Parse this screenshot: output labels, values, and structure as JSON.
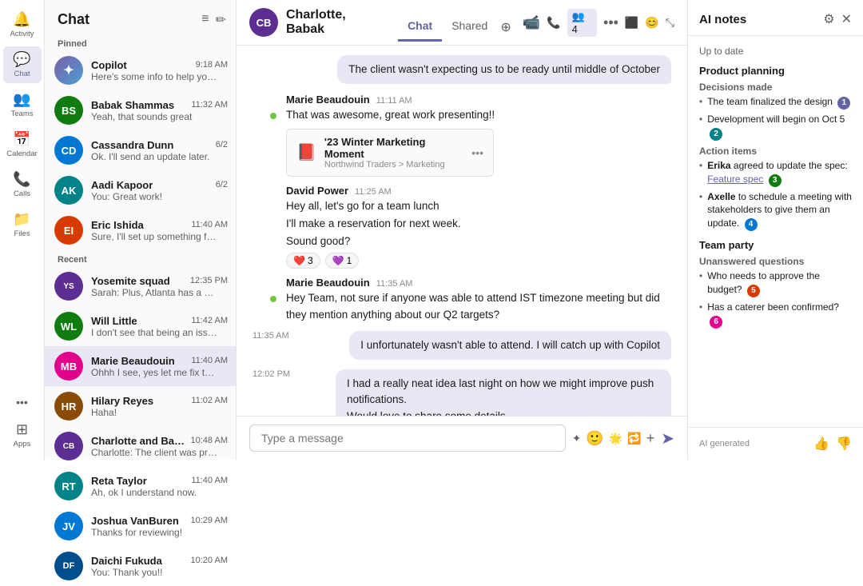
{
  "nav": {
    "items": [
      {
        "id": "activity",
        "label": "Activity",
        "icon": "🔔",
        "active": false
      },
      {
        "id": "chat",
        "label": "Chat",
        "icon": "💬",
        "active": true
      },
      {
        "id": "teams",
        "label": "Teams",
        "icon": "👥",
        "active": false
      },
      {
        "id": "calendar",
        "label": "Calendar",
        "icon": "📅",
        "active": false
      },
      {
        "id": "calls",
        "label": "Calls",
        "icon": "📞",
        "active": false
      },
      {
        "id": "files",
        "label": "Files",
        "icon": "📁",
        "active": false
      },
      {
        "id": "more",
        "label": "···",
        "icon": "···",
        "active": false
      },
      {
        "id": "apps",
        "label": "Apps",
        "icon": "⊞",
        "active": false
      }
    ]
  },
  "chatList": {
    "title": "Chat",
    "pinnedLabel": "Pinned",
    "recentLabel": "Recent",
    "pinned": [
      {
        "id": "copilot",
        "name": "Copilot",
        "preview": "Here's some info to help you prep for your...",
        "time": "9:18 AM",
        "avatarColor": "copilot",
        "initials": "🤖",
        "online": false
      },
      {
        "id": "babak",
        "name": "Babak Shammas",
        "preview": "Yeah, that sounds great",
        "time": "11:32 AM",
        "avatarColor": "green",
        "initials": "BS",
        "online": false
      },
      {
        "id": "cassandra",
        "name": "Cassandra Dunn",
        "preview": "Ok. I'll send an update later.",
        "time": "6/2",
        "avatarColor": "blue",
        "initials": "CD",
        "online": false
      },
      {
        "id": "aadi",
        "name": "Aadi Kapoor",
        "preview": "You: Great work!",
        "time": "6/2",
        "avatarColor": "teal",
        "initials": "AK",
        "online": false
      },
      {
        "id": "eric",
        "name": "Eric Ishida",
        "preview": "Sure, I'll set up something for next week t...",
        "time": "11:40 AM",
        "avatarColor": "orange",
        "initials": "EI",
        "online": false
      }
    ],
    "recent": [
      {
        "id": "yosemite",
        "name": "Yosemite squad",
        "preview": "Sarah: Plus, Atlanta has a growing tech...",
        "time": "12:35 PM",
        "avatarColor": "purple",
        "initials": "YS",
        "online": false
      },
      {
        "id": "will",
        "name": "Will Little",
        "preview": "I don't see that being an issue. Can you ta...",
        "time": "11:42 AM",
        "avatarColor": "green",
        "initials": "WL",
        "online": false
      },
      {
        "id": "marie",
        "name": "Marie Beaudouin",
        "preview": "Ohhh I see, yes let me fix that!",
        "time": "11:40 AM",
        "avatarColor": "pink",
        "initials": "MB",
        "online": false
      },
      {
        "id": "hilary",
        "name": "Hilary Reyes",
        "preview": "Haha!",
        "time": "11:02 AM",
        "avatarColor": "brown",
        "initials": "HR",
        "online": false
      },
      {
        "id": "charlotte",
        "name": "Charlotte and Babak",
        "preview": "Charlotte: The client was pretty happy with...",
        "time": "10:48 AM",
        "avatarColor": "purple",
        "initials": "CB",
        "online": false
      },
      {
        "id": "reta",
        "name": "Reta Taylor",
        "preview": "Ah, ok I understand now.",
        "time": "11:40 AM",
        "avatarColor": "teal",
        "initials": "RT",
        "online": false
      },
      {
        "id": "joshua",
        "name": "Joshua VanBuren",
        "preview": "Thanks for reviewing!",
        "time": "10:29 AM",
        "avatarColor": "blue",
        "initials": "JV",
        "online": false
      },
      {
        "id": "daichi",
        "name": "Daichi Fukuda",
        "preview": "You: Thank you!!",
        "time": "10:20 AM",
        "avatarColor": "darkblue",
        "initials": "DF",
        "online": false
      }
    ]
  },
  "header": {
    "name": "Charlotte, Babak",
    "tab_chat": "Chat",
    "tab_shared": "Shared"
  },
  "messages": [
    {
      "id": "m1",
      "type": "bubble-right",
      "text": "The client wasn't expecting us to be ready until middle of October"
    },
    {
      "id": "m2",
      "type": "left",
      "sender": "Marie Beaudouin",
      "time": "11:11 AM",
      "avatarColor": "pink",
      "initials": "MB",
      "online": true,
      "text": "That was awesome, great work presenting!!",
      "hasFile": true,
      "fileName": "'23 Winter Marketing Moment",
      "filePath": "Northwind Traders > Marketing"
    },
    {
      "id": "m3",
      "type": "left",
      "sender": "David Power",
      "time": "11:25 AM",
      "avatarColor": "blue",
      "initials": "DP",
      "online": false,
      "lines": [
        "Hey all, let's go for a team lunch",
        "I'll make a reservation for next week.",
        "Sound good?"
      ],
      "reactions": [
        {
          "emoji": "❤️",
          "count": "3"
        },
        {
          "emoji": "💜",
          "count": "1"
        }
      ]
    },
    {
      "id": "m4",
      "type": "left",
      "sender": "Marie Beaudouin",
      "time": "11:35 AM",
      "avatarColor": "pink",
      "initials": "MB",
      "online": true,
      "text": "Hey Team, not sure if anyone was able to attend IST timezone meeting but did they mention anything about our Q2 targets?"
    },
    {
      "id": "m5",
      "type": "bubble-right",
      "timestamp": "11:35 AM",
      "text": "I unfortunately wasn't able to attend. I will catch up with Copilot"
    },
    {
      "id": "m6",
      "type": "bubble-right",
      "timestamp": "12:02 PM",
      "lines": [
        "I had a really neat idea last night on how we might improve push notifications.",
        "Would love to share some details"
      ]
    }
  ],
  "inputPlaceholder": "Type a message",
  "aiNotes": {
    "title": "AI notes",
    "dateLabel": "Up to date",
    "sections": [
      {
        "title": "Product planning",
        "subsections": [
          {
            "label": "Decisions made",
            "bullets": [
              {
                "text": "The team finalized the design",
                "badge": "1",
                "badgeColor": "badge-purple"
              },
              {
                "text": "Development will begin on Oct 5",
                "badge": "2",
                "badgeColor": "badge-teal"
              }
            ]
          },
          {
            "label": "Action items",
            "bullets": [
              {
                "boldName": "Erika",
                "text": " agreed to update the spec: ",
                "link": "Feature spec",
                "badge": "3",
                "badgeColor": "badge-green"
              },
              {
                "boldName": "Axelle",
                "text": " to schedule a meeting with stakeholders to give them an update.",
                "badge": "4",
                "badgeColor": "badge-blue"
              }
            ]
          }
        ]
      },
      {
        "title": "Team party",
        "subsections": [
          {
            "label": "Unanswered questions",
            "bullets": [
              {
                "text": "Who needs to approve the budget?",
                "badge": "5",
                "badgeColor": "badge-orange"
              },
              {
                "text": "Has a caterer been confirmed?",
                "badge": "6",
                "badgeColor": "badge-pink"
              }
            ]
          }
        ]
      }
    ],
    "footerLabel": "AI generated"
  }
}
